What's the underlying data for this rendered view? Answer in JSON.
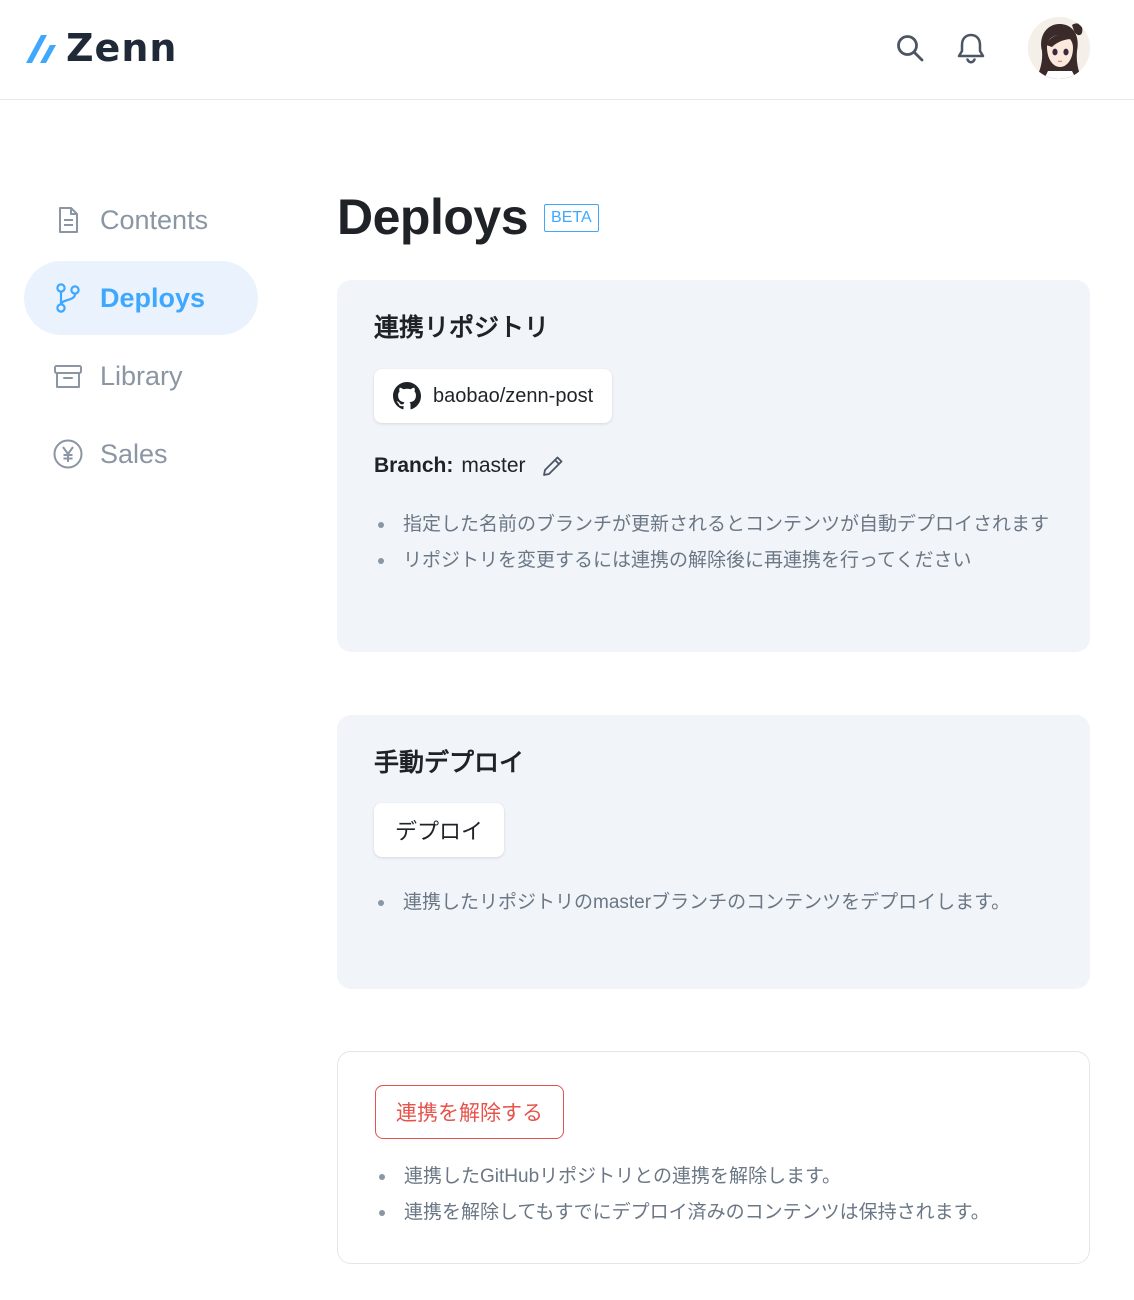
{
  "header": {
    "logo_text": "Zenn",
    "logo_icon": "zenn-logo-icon",
    "search_icon": "search-icon",
    "bell_icon": "bell-icon",
    "avatar": "user-avatar",
    "accent_color": "#3ea8ff"
  },
  "sidebar": {
    "items": [
      {
        "label": "Contents",
        "icon": "document-icon",
        "active": false
      },
      {
        "label": "Deploys",
        "icon": "git-branch-icon",
        "active": true
      },
      {
        "label": "Library",
        "icon": "archive-icon",
        "active": false
      },
      {
        "label": "Sales",
        "icon": "yen-icon",
        "active": false
      }
    ]
  },
  "main": {
    "title": "Deploys",
    "badge": "BETA",
    "repo_card": {
      "title": "連携リポジトリ",
      "repo_name": "baobao/zenn-post",
      "repo_icon": "github-icon",
      "branch_label": "Branch:",
      "branch_value": "master",
      "edit_icon": "pencil-icon",
      "notes": [
        "指定した名前のブランチが更新されるとコンテンツが自動デプロイされます",
        "リポジトリを変更するには連携の解除後に再連携を行ってください"
      ]
    },
    "manual_card": {
      "title": "手動デプロイ",
      "button_label": "デプロイ",
      "notes": [
        "連携したリポジトリのmasterブランチのコンテンツをデプロイします。"
      ]
    },
    "danger_card": {
      "button_label": "連携を解除する",
      "danger_color": "#e5534b",
      "notes": [
        "連携したGitHubリポジトリとの連携を解除します。",
        "連携を解除してもすでにデプロイ済みのコンテンツは保持されます。"
      ]
    }
  }
}
